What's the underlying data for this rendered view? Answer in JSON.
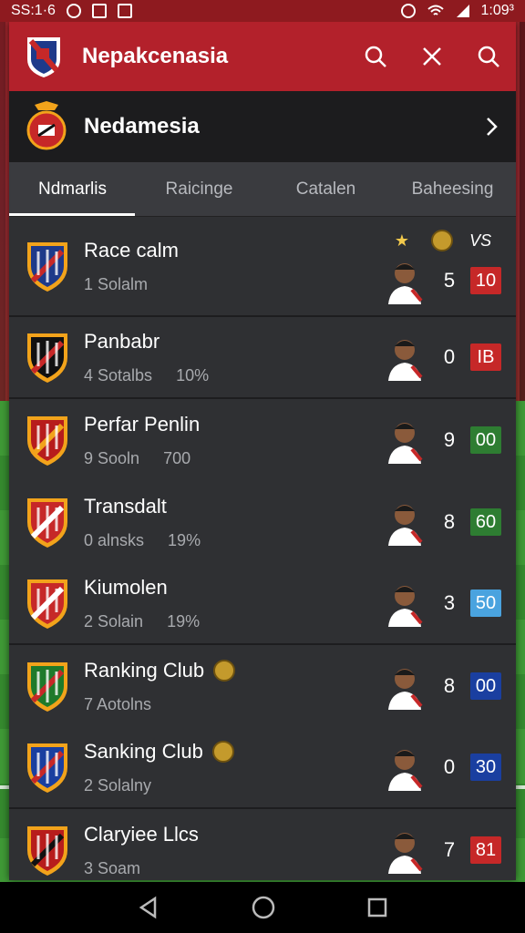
{
  "status_bar": {
    "time": "SS:1·6",
    "right_time": "1:09³"
  },
  "app": {
    "title": "Nepakcenasia",
    "icons": [
      "search-icon",
      "close-icon",
      "search-icon"
    ]
  },
  "league": {
    "name": "Nedamesia"
  },
  "tabs": [
    {
      "label": "Ndmarlis",
      "active": true
    },
    {
      "label": "Raicinge",
      "active": false
    },
    {
      "label": "Catalen",
      "active": false
    },
    {
      "label": "Baheesing",
      "active": false
    }
  ],
  "header_row": {
    "col1": "★",
    "col3": "VS"
  },
  "rows": [
    {
      "team": "Race calm",
      "sub": "1 Solalm",
      "pct": "",
      "num": "5",
      "badge": "10",
      "badge_color": "#c62828",
      "coin": false,
      "crest_color": "#1e3a8a",
      "accent": "#c62828"
    },
    {
      "team": "Panbabr",
      "sub": "4 Sotalbs",
      "pct": "10%",
      "num": "0",
      "badge": "IB",
      "badge_color": "#c62828",
      "coin": false,
      "crest_color": "#111111",
      "accent": "#c62828"
    },
    {
      "team": "Perfar Penlin",
      "sub": "9 Sooln",
      "pct": "700",
      "num": "9",
      "badge": "00",
      "badge_color": "#2e7d32",
      "coin": false,
      "crest_color": "#b71c1c",
      "accent": "#f2a31b"
    },
    {
      "team": "Transdalt",
      "sub": "0 alnsks",
      "pct": "19%",
      "num": "8",
      "badge": "60",
      "badge_color": "#2e7d32",
      "coin": false,
      "crest_color": "#c62828",
      "accent": "#ffffff"
    },
    {
      "team": "Kiumolen",
      "sub": "2 Solain",
      "pct": "19%",
      "num": "3",
      "badge": "50",
      "badge_color": "#4aa3df",
      "coin": false,
      "crest_color": "#c62828",
      "accent": "#ffffff"
    },
    {
      "team": "Ranking Club",
      "sub": "7 Aotolns",
      "pct": "",
      "num": "8",
      "badge": "00",
      "badge_color": "#1a3fa0",
      "coin": true,
      "crest_color": "#1f7a2b",
      "accent": "#c62828"
    },
    {
      "team": "Sanking Club",
      "sub": "2 Solalny",
      "pct": "",
      "num": "0",
      "badge": "30",
      "badge_color": "#1a3fa0",
      "coin": true,
      "crest_color": "#1a3fa0",
      "accent": "#c62828"
    },
    {
      "team": "Claryiee Llcs",
      "sub": "3 Soam",
      "pct": "",
      "num": "7",
      "badge": "81",
      "badge_color": "#c62828",
      "coin": false,
      "crest_color": "#b71c1c",
      "accent": "#111111"
    }
  ],
  "nav": [
    "back-icon",
    "home-icon",
    "recents-icon"
  ]
}
